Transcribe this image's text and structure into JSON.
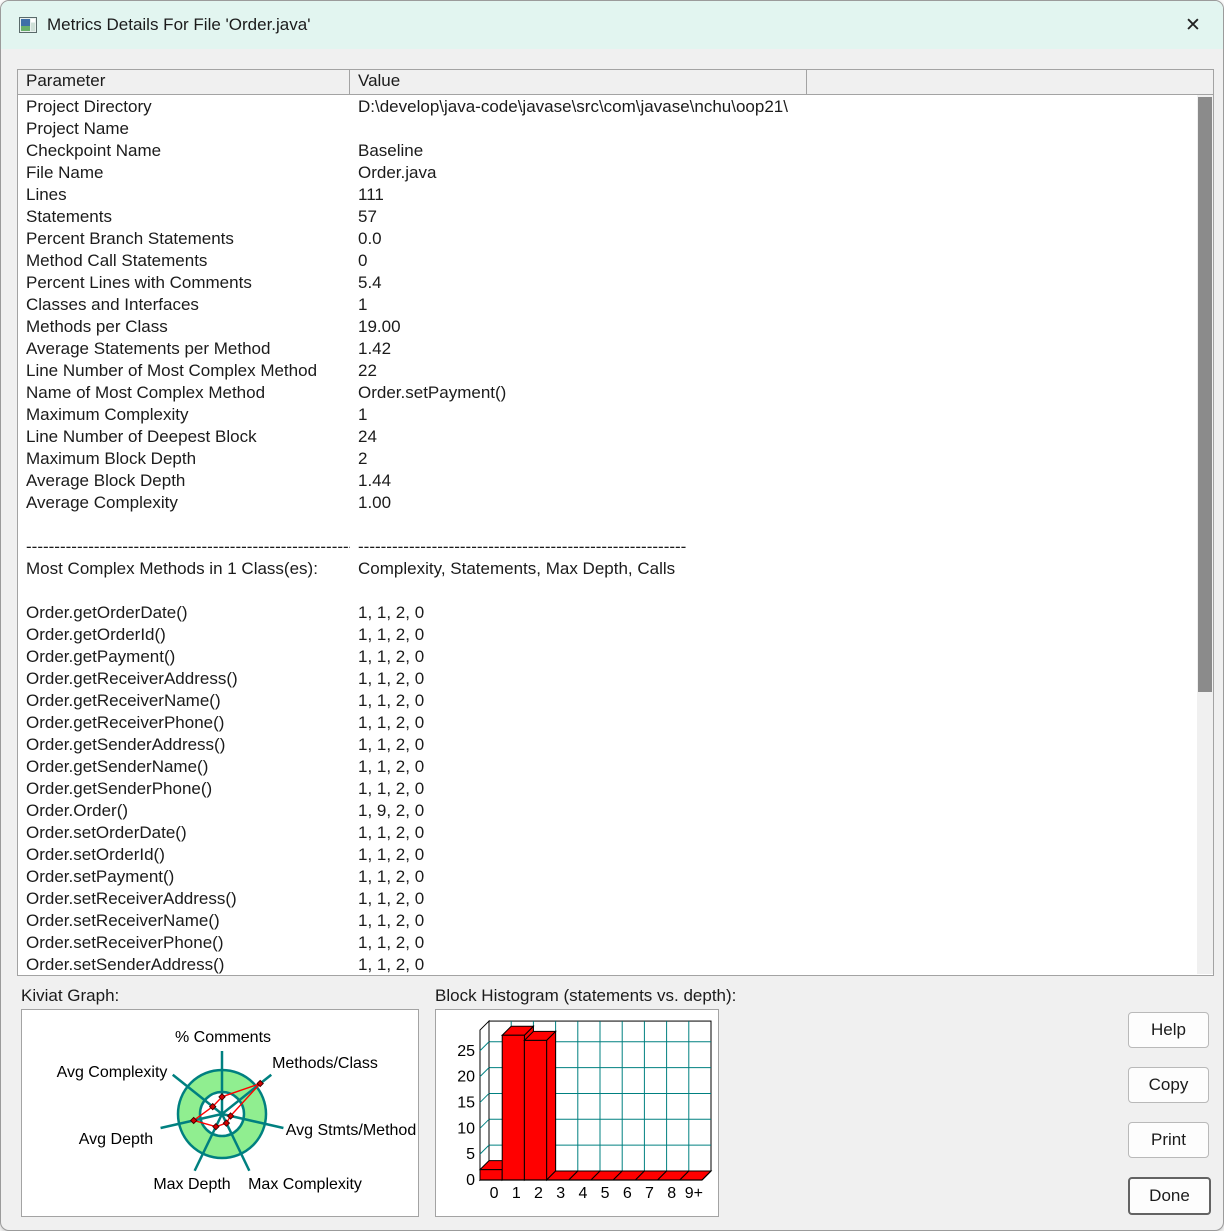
{
  "window": {
    "title": "Metrics Details For File 'Order.java'",
    "close_glyph": "✕"
  },
  "table": {
    "columns": [
      "Parameter",
      "Value",
      ""
    ],
    "rows": [
      {
        "p": "Project Directory",
        "v": "D:\\develop\\java-code\\javase\\src\\com\\javase\\nchu\\oop21\\"
      },
      {
        "p": "Project Name",
        "v": ""
      },
      {
        "p": "Checkpoint Name",
        "v": "Baseline"
      },
      {
        "p": "File Name",
        "v": "Order.java"
      },
      {
        "p": "Lines",
        "v": "111"
      },
      {
        "p": "Statements",
        "v": "57"
      },
      {
        "p": "Percent Branch Statements",
        "v": "0.0"
      },
      {
        "p": "Method Call Statements",
        "v": "0"
      },
      {
        "p": "Percent Lines with Comments",
        "v": "5.4"
      },
      {
        "p": "Classes and Interfaces",
        "v": "1"
      },
      {
        "p": "Methods per Class",
        "v": "19.00"
      },
      {
        "p": "Average Statements per Method",
        "v": "1.42"
      },
      {
        "p": "Line Number of Most Complex Method",
        "v": "22"
      },
      {
        "p": "Name of Most Complex Method",
        "v": "Order.setPayment()"
      },
      {
        "p": "Maximum Complexity",
        "v": "1"
      },
      {
        "p": "Line Number of Deepest Block",
        "v": "24"
      },
      {
        "p": "Maximum Block Depth",
        "v": "2"
      },
      {
        "p": "Average Block Depth",
        "v": "1.44"
      },
      {
        "p": "Average Complexity",
        "v": "1.00"
      },
      {
        "p": "",
        "v": ""
      },
      {
        "p": "----------------------------------------------------------",
        "v": "----------------------------------------------------------"
      },
      {
        "p": "Most Complex Methods in 1 Class(es):",
        "v": "Complexity, Statements, Max Depth, Calls"
      },
      {
        "p": "",
        "v": ""
      },
      {
        "p": "Order.getOrderDate()",
        "v": "1, 1, 2, 0"
      },
      {
        "p": "Order.getOrderId()",
        "v": "1, 1, 2, 0"
      },
      {
        "p": "Order.getPayment()",
        "v": "1, 1, 2, 0"
      },
      {
        "p": "Order.getReceiverAddress()",
        "v": "1, 1, 2, 0"
      },
      {
        "p": "Order.getReceiverName()",
        "v": "1, 1, 2, 0"
      },
      {
        "p": "Order.getReceiverPhone()",
        "v": "1, 1, 2, 0"
      },
      {
        "p": "Order.getSenderAddress()",
        "v": "1, 1, 2, 0"
      },
      {
        "p": "Order.getSenderName()",
        "v": "1, 1, 2, 0"
      },
      {
        "p": "Order.getSenderPhone()",
        "v": "1, 1, 2, 0"
      },
      {
        "p": "Order.Order()",
        "v": "1, 9, 2, 0"
      },
      {
        "p": "Order.setOrderDate()",
        "v": "1, 1, 2, 0"
      },
      {
        "p": "Order.setOrderId()",
        "v": "1, 1, 2, 0"
      },
      {
        "p": "Order.setPayment()",
        "v": "1, 1, 2, 0"
      },
      {
        "p": "Order.setReceiverAddress()",
        "v": "1, 1, 2, 0"
      },
      {
        "p": "Order.setReceiverName()",
        "v": "1, 1, 2, 0"
      },
      {
        "p": "Order.setReceiverPhone()",
        "v": "1, 1, 2, 0"
      },
      {
        "p": "Order.setSenderAddress()",
        "v": "1, 1, 2, 0"
      }
    ]
  },
  "sections": {
    "kiviat_label": "Kiviat Graph:",
    "histogram_label": "Block Histogram (statements vs. depth):"
  },
  "buttons": {
    "help": "Help",
    "copy": "Copy",
    "print": "Print",
    "done": "Done"
  },
  "chart_data": [
    {
      "type": "radar",
      "title": "Kiviat Graph:",
      "axes": [
        "% Comments",
        "Methods/Class",
        "Avg Stmts/Method",
        "Max Complexity",
        "Max Depth",
        "Avg Depth",
        "Avg Complexity"
      ],
      "values_ring_relative": [
        0.39,
        1.11,
        0.2,
        0.23,
        0.32,
        0.66,
        0.27
      ],
      "ring_inner": 0.5,
      "ring_outer": 1.0,
      "colors": {
        "ring": "#90EE90",
        "axis": "#008080",
        "series": "#ff0000"
      }
    },
    {
      "type": "bar",
      "title": "Block Histogram (statements vs. depth):",
      "categories": [
        "0",
        "1",
        "2",
        "3",
        "4",
        "5",
        "6",
        "7",
        "8",
        "9+"
      ],
      "values": [
        2,
        28,
        27,
        0,
        0,
        0,
        0,
        0,
        0,
        0
      ],
      "xlabel": "depth",
      "ylabel": "statements",
      "yticks": [
        0,
        5,
        10,
        15,
        20,
        25
      ],
      "ylim": [
        0,
        29
      ],
      "style": "3d",
      "bar_color": "#ff0000",
      "grid_color": "#008080"
    }
  ]
}
